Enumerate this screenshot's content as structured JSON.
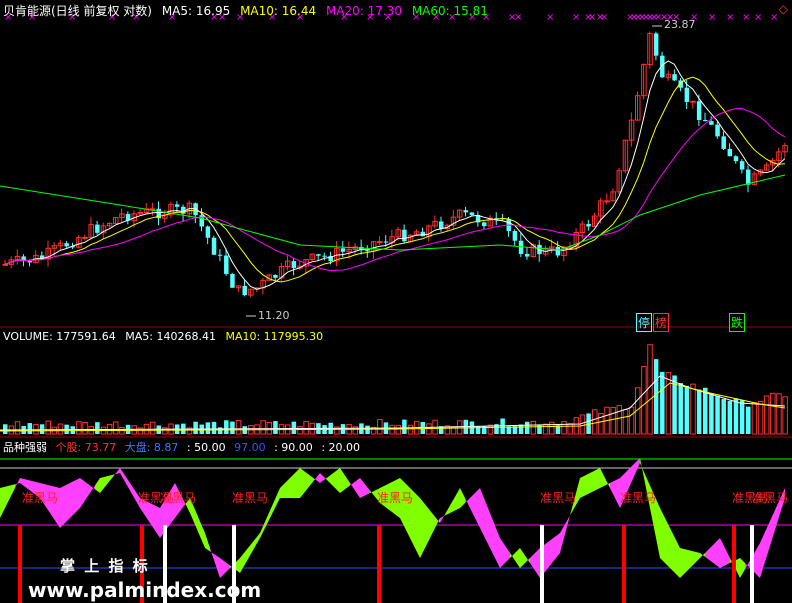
{
  "main": {
    "title": "贝肯能源(日线 前复权 对数)",
    "ma5_label": "MA5: 16.95",
    "ma10_label": "MA10: 16.44",
    "ma20_label": "MA20: 17.30",
    "ma60_label": "MA60: 15.81",
    "high_marker": "23.87",
    "low_marker": "11.20",
    "badge_stop": "停",
    "badge_list": "榜",
    "badge_drop": "跌",
    "corner_icon": "diamond-icon"
  },
  "volume": {
    "vol_label": "VOLUME: 177591.64",
    "ma5_label": "MA5: 140268.41",
    "ma10_label": "MA10: 117995.30"
  },
  "indicator": {
    "name": "品种强弱",
    "stock_label": "个股: 73.77",
    "market_label": "大盘: 8.87",
    "level1": ": 50.00",
    "level2": "97.00",
    "level3": ": 90.00",
    "level4": ": 20.00",
    "signal_text": "准黑马",
    "watermark_top": "掌 上 指 标",
    "watermark_url": "www.palmindex.com"
  },
  "colors": {
    "ma5": "#ffffff",
    "ma10": "#ffff00",
    "ma20": "#ff00ff",
    "ma60": "#00ff00",
    "up": "#ff3030",
    "down": "#54ffff",
    "bg": "#000000"
  }
}
